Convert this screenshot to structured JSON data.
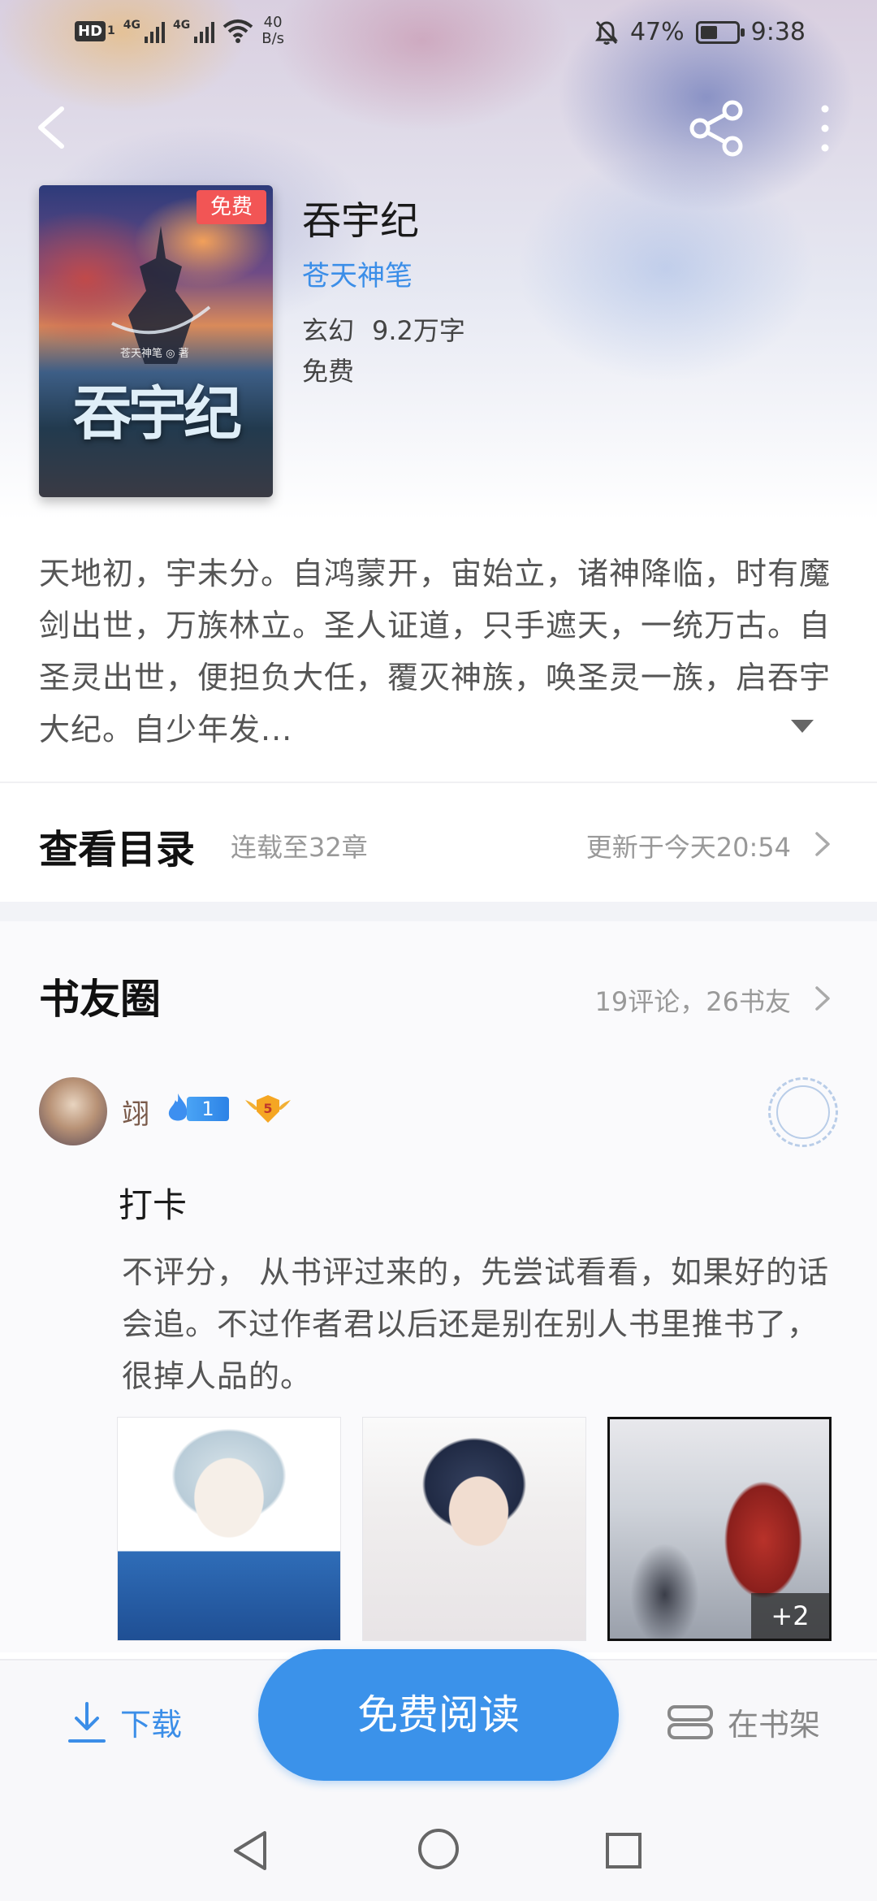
{
  "status_bar": {
    "hd": "HD",
    "sim1": "1",
    "net1": "4G",
    "net2": "4G",
    "speed_value": "40",
    "speed_unit": "B/s",
    "battery_percent": "47%",
    "battery_level": 0.47,
    "time": "9:38"
  },
  "book": {
    "cover_badge": "免费",
    "cover_title": "吞宇纪",
    "cover_author": "苍天神笔 ◎ 著",
    "title": "吞宇纪",
    "author": "苍天神笔",
    "genre": "玄幻",
    "word_count": "9.2万字",
    "price": "免费"
  },
  "synopsis": "天地初，宇未分。自鸿蒙开，宙始立，诸神降临，时有魔剑出世，万族林立。圣人证道，只手遮天，一统万古。自圣灵出世，便担负大任，覆灭神族，唤圣灵一族，启吞宇大纪。自少年发...",
  "catalog": {
    "title": "查看目录",
    "status": "连载至32章",
    "updated": "更新于今天20:54"
  },
  "book_circle": {
    "title": "书友圈",
    "stats": "19评论，26书友"
  },
  "post": {
    "username": "翊",
    "level": "1",
    "rank": "5",
    "title": "打卡",
    "body": "不评分， 从书评过来的，先尝试看看，如果好的话会追。不过作者君以后还是别在别人书里推书了，很掉人品的。",
    "more_images": "+2"
  },
  "bottom_bar": {
    "download": "下载",
    "read": "免费阅读",
    "shelf": "在书架"
  },
  "colors": {
    "accent": "#3b92ea",
    "link": "#3b8ee8",
    "badge_red": "#f25555"
  }
}
